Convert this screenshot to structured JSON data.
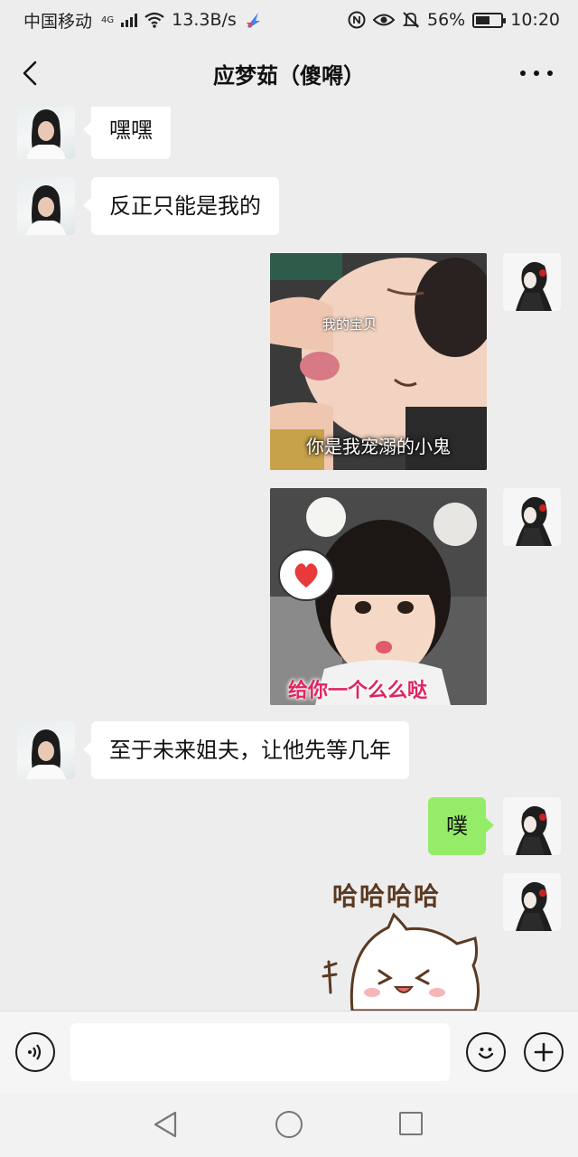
{
  "status_bar": {
    "carrier": "中国移动",
    "network": "4G",
    "speed": "13.3B/s",
    "battery": "56%",
    "battery_level": 0.56,
    "time": "10:20"
  },
  "header": {
    "title": "应梦茹（傻嘚）"
  },
  "messages": [
    {
      "from": "them",
      "type": "text",
      "text": "嘿嘿"
    },
    {
      "from": "them",
      "type": "text",
      "text": "反正只能是我的"
    },
    {
      "from": "me",
      "type": "image",
      "caption_top": "我的宝贝",
      "caption_bottom": "你是我宠溺的小鬼"
    },
    {
      "from": "me",
      "type": "image",
      "caption_bottom": "给你一个么么哒"
    },
    {
      "from": "them",
      "type": "text",
      "text": "至于未来姐夫，让他先等几年"
    },
    {
      "from": "me",
      "type": "text",
      "text": "噗"
    },
    {
      "from": "me",
      "type": "sticker",
      "caption_top": "哈哈哈哈"
    }
  ],
  "input": {
    "placeholder": ""
  },
  "icons": {
    "back": "chevron-left-icon",
    "more": "more-dots-icon",
    "voice": "voice-icon",
    "emoji": "emoji-icon",
    "plus": "plus-icon"
  },
  "colors": {
    "background": "#ededed",
    "outgoing_bubble": "#95ec69",
    "incoming_bubble": "#ffffff"
  }
}
